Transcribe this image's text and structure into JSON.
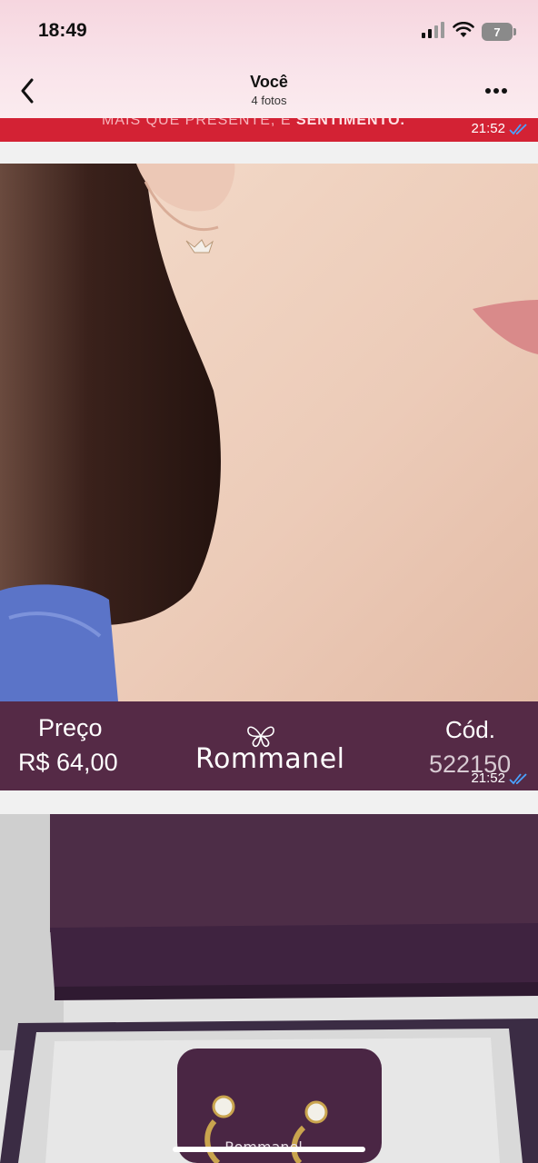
{
  "status_bar": {
    "time": "18:49",
    "battery_level": "7"
  },
  "nav": {
    "title": "Você",
    "subtitle": "4 fotos"
  },
  "photo1": {
    "caption_part1": "MAIS QUE PRESENTE, É ",
    "caption_part2": "SENTIMENTO.",
    "timestamp": "21:52"
  },
  "photo2": {
    "price_label": "Preço",
    "price_value": "R$ 64,00",
    "brand": "Rommanel",
    "code_label": "Cód.",
    "code_value": "522150",
    "timestamp": "21:52"
  },
  "colors": {
    "header_bg": "#f9e3ea",
    "banner_bg": "#552a46",
    "strip_red": "#d32234",
    "read_receipt": "#4aa3ff"
  },
  "icons": [
    "back-chevron-icon",
    "more-icon",
    "signal-icon",
    "wifi-icon",
    "battery-icon",
    "double-check-icon",
    "butterfly-logo-icon"
  ]
}
